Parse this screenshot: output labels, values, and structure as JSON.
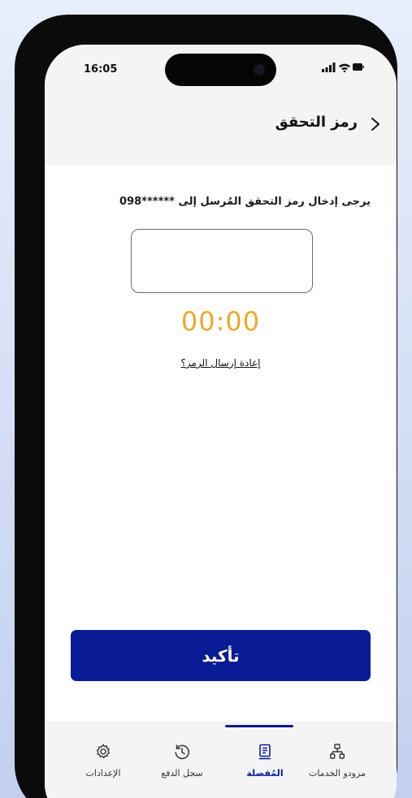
{
  "status_bar": {
    "time": "16:05"
  },
  "header": {
    "title": "رمز التحقق",
    "back_icon": "chevron-right-icon"
  },
  "main": {
    "instruction": "يرجى إدخال رمز التحقق المُرسل إلى ******098",
    "otp_value": "",
    "timer": "00:00",
    "resend_link": "إعادة إرسال الرمز؟",
    "confirm_label": "تأكيد"
  },
  "tabbar": {
    "active_index": 1,
    "items": [
      {
        "label": "مزودو الخدمات",
        "icon": "sitemap-icon"
      },
      {
        "label": "المُفضلة",
        "icon": "bookmark-icon"
      },
      {
        "label": "سجل الدفع",
        "icon": "history-icon"
      },
      {
        "label": "الإعدادات",
        "icon": "gear-icon"
      }
    ]
  },
  "colors": {
    "primary": "#0a1b96",
    "timer": "#f2a62a",
    "header_bg": "#f4f4f4"
  }
}
